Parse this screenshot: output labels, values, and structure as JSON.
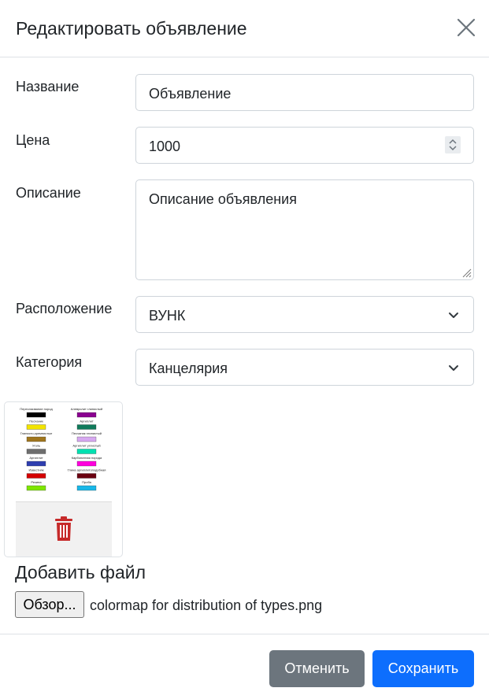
{
  "modal": {
    "title": "Редактировать объявление"
  },
  "form": {
    "name_label": "Название",
    "name_value": "Объявление",
    "price_label": "Цена",
    "price_value": "1000",
    "description_label": "Описание",
    "description_value": "Описание объявления",
    "location_label": "Расположение",
    "location_value": "ВУНК",
    "category_label": "Категория",
    "category_value": "Канцелярия"
  },
  "image_preview": {
    "legend_left": [
      {
        "label": "Переслаивание пород",
        "color": "#000000"
      },
      {
        "label": "Песчаник",
        "color": "#f2e400"
      },
      {
        "label": "Глинисто-кремнистые",
        "color": "#a0761e"
      },
      {
        "label": "Уголь",
        "color": "#6e6e6e"
      },
      {
        "label": "Аргиллит",
        "color": "#2f3fb0"
      },
      {
        "label": "Известняк",
        "color": "#d40000"
      },
      {
        "label": "Резина",
        "color": "#7ee600"
      }
    ],
    "legend_right": [
      {
        "label": "Алевролит глинистый",
        "color": "#8a0090"
      },
      {
        "label": "Аргиллит",
        "color": "#0f7a5a"
      },
      {
        "label": "Песчаник глинистый",
        "color": "#d6a8f0"
      },
      {
        "label": "Аргиллит углистый",
        "color": "#00e0b0"
      },
      {
        "label": "Карбонатная порода",
        "color": "#ff00dd"
      },
      {
        "label": "Глина аргиллитоподобная",
        "color": "#6a0010"
      },
      {
        "label": "Проба",
        "color": "#18b7e8"
      }
    ]
  },
  "file_upload": {
    "title": "Добавить файл",
    "browse_label": "Обзор...",
    "file_name": "colormap for distribution of types.png"
  },
  "footer": {
    "cancel_label": "Отменить",
    "save_label": "Сохранить"
  },
  "colors": {
    "primary": "#0d6efd",
    "secondary": "#6c757d",
    "danger": "#c62a2a"
  }
}
